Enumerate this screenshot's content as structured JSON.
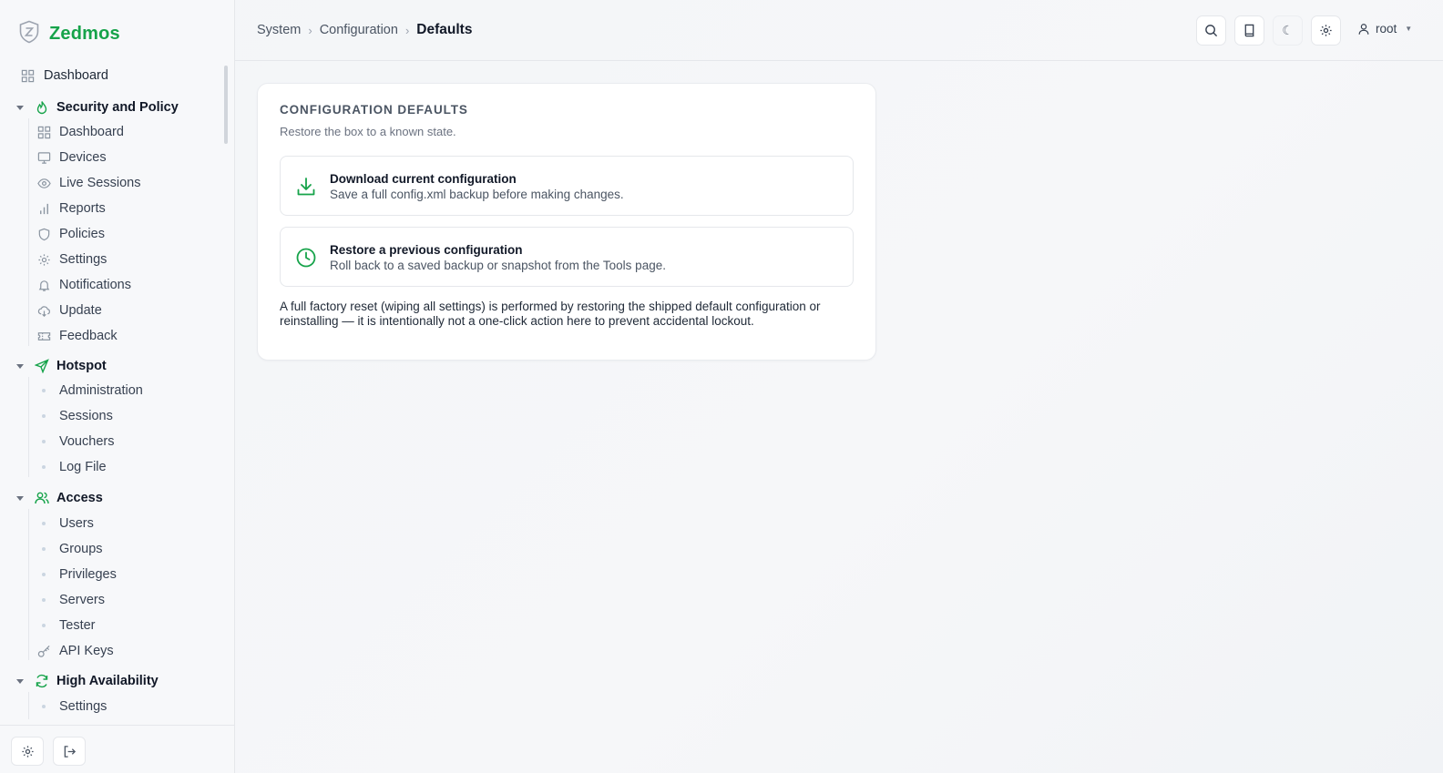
{
  "brand": {
    "name": "Zedmos"
  },
  "sidebar": {
    "top_item": {
      "label": "Dashboard",
      "icon": "grid-icon"
    },
    "sections": [
      {
        "label": "Security and Policy",
        "icon": "flame-icon",
        "items": [
          {
            "label": "Dashboard",
            "icon": "grid-icon"
          },
          {
            "label": "Devices",
            "icon": "monitor-icon"
          },
          {
            "label": "Live Sessions",
            "icon": "eye-icon"
          },
          {
            "label": "Reports",
            "icon": "bar-chart-icon"
          },
          {
            "label": "Policies",
            "icon": "shield-icon"
          },
          {
            "label": "Settings",
            "icon": "gear-icon"
          },
          {
            "label": "Notifications",
            "icon": "bell-icon"
          },
          {
            "label": "Update",
            "icon": "cloud-download-icon"
          },
          {
            "label": "Feedback",
            "icon": "ticket-icon"
          }
        ]
      },
      {
        "label": "Hotspot",
        "icon": "send-icon",
        "items": [
          {
            "label": "Administration"
          },
          {
            "label": "Sessions"
          },
          {
            "label": "Vouchers"
          },
          {
            "label": "Log File"
          }
        ]
      },
      {
        "label": "Access",
        "icon": "users-icon",
        "items": [
          {
            "label": "Users"
          },
          {
            "label": "Groups"
          },
          {
            "label": "Privileges"
          },
          {
            "label": "Servers"
          },
          {
            "label": "Tester"
          },
          {
            "label": "API Keys",
            "icon": "key-icon"
          }
        ]
      },
      {
        "label": "High Availability",
        "icon": "refresh-icon",
        "items": [
          {
            "label": "Settings"
          }
        ]
      }
    ]
  },
  "header": {
    "breadcrumb": [
      "System",
      "Configuration",
      "Defaults"
    ],
    "user": "root",
    "theme_toggle_glyph": "☾"
  },
  "card": {
    "title": "CONFIGURATION DEFAULTS",
    "subtitle": "Restore the box to a known state.",
    "options": [
      {
        "title": "Download current configuration",
        "description": "Save a full config.xml backup before making changes.",
        "icon": "download-icon"
      },
      {
        "title": "Restore a previous configuration",
        "description": "Roll back to a saved backup or snapshot from the Tools page.",
        "icon": "clock-icon"
      }
    ],
    "note": "A full factory reset (wiping all settings) is performed by restoring the shipped default configuration or reinstalling — it is intentionally not a one-click action here to prevent accidental lockout."
  },
  "colors": {
    "accent": "#16a34a",
    "text": "#111827",
    "muted": "#6b7280",
    "border": "#e5e7eb"
  }
}
